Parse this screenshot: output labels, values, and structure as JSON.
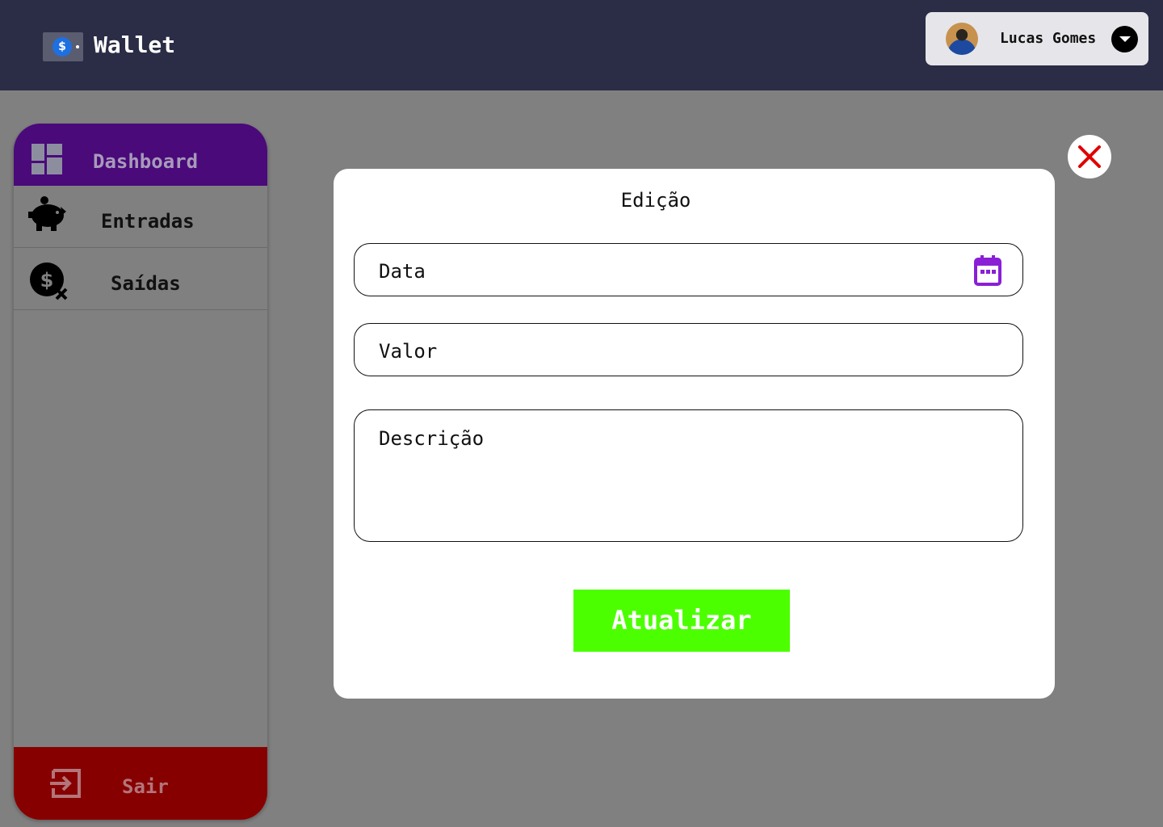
{
  "header": {
    "brand": {
      "icon": "wallet-icon",
      "title": "Wallet"
    },
    "user": {
      "name": "Lucas Gomes",
      "avatar": "user-avatar",
      "menu_icon": "chevron-down-icon"
    }
  },
  "sidebar": {
    "items": [
      {
        "label": "Dashboard",
        "icon": "dashboard-icon",
        "active": true
      },
      {
        "label": "Entradas",
        "icon": "piggy-bank-icon"
      },
      {
        "label": "Saídas",
        "icon": "money-off-icon"
      }
    ],
    "logout": {
      "label": "Sair",
      "icon": "logout-icon"
    }
  },
  "modal": {
    "title": "Edição",
    "fields": {
      "date": {
        "placeholder": "Data",
        "value": "",
        "icon": "calendar-icon"
      },
      "amount": {
        "placeholder": "Valor",
        "value": ""
      },
      "description": {
        "placeholder": "Descrição",
        "value": ""
      }
    },
    "submit_label": "Atualizar",
    "close_icon": "close-icon"
  },
  "colors": {
    "header_bg": "#2b2d46",
    "page_bg": "#808080",
    "active_nav": "#4a0a7a",
    "logout_bg": "#870000",
    "submit_bg": "#4cff00",
    "calendar_icon": "#8a1fd6",
    "close_icon": "#e00000"
  }
}
